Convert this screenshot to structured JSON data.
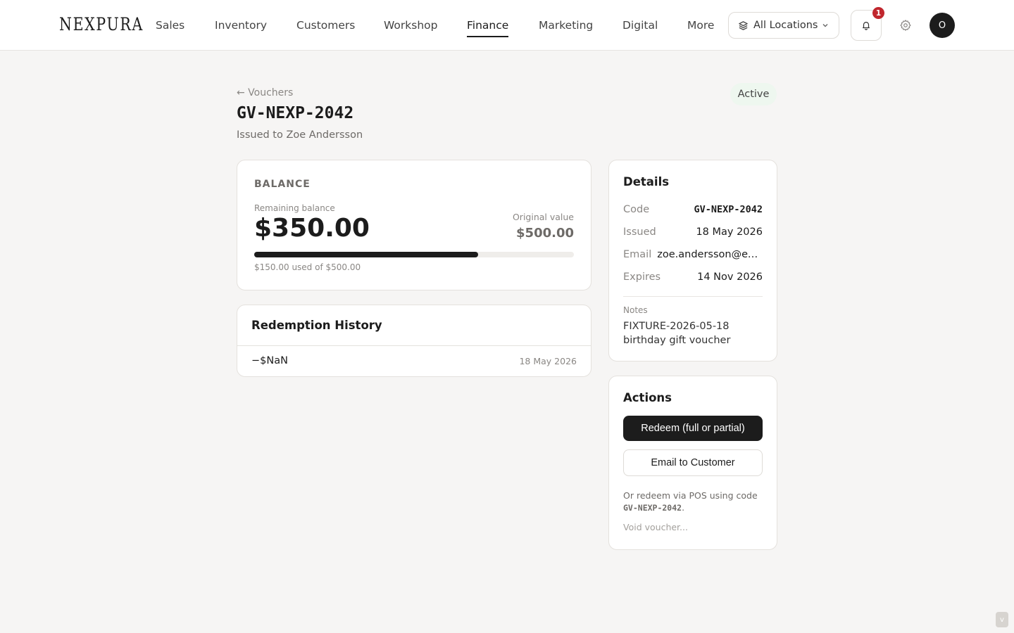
{
  "brand": {
    "logo": "NEXPURA"
  },
  "nav": {
    "items": [
      {
        "label": "Sales",
        "active": false
      },
      {
        "label": "Inventory",
        "active": false
      },
      {
        "label": "Customers",
        "active": false
      },
      {
        "label": "Workshop",
        "active": false
      },
      {
        "label": "Finance",
        "active": true
      },
      {
        "label": "Marketing",
        "active": false
      },
      {
        "label": "Digital",
        "active": false
      },
      {
        "label": "More",
        "active": false
      }
    ],
    "location_selector": "All Locations",
    "notification_count": "1",
    "avatar_initial": "O"
  },
  "header": {
    "back_link": "← Vouchers",
    "title": "GV-NEXP-2042",
    "subtitle": "Issued to Zoe Andersson",
    "status": "Active"
  },
  "balance": {
    "section_label": "BALANCE",
    "remaining_label": "Remaining balance",
    "remaining_value": "$350.00",
    "original_label": "Original value",
    "original_value": "$500.00",
    "used_fraction": 0.7,
    "used_text": "$150.00 used of $500.00"
  },
  "history": {
    "title": "Redemption History",
    "rows": [
      {
        "amount": "−$NaN",
        "date": "18 May 2026"
      }
    ]
  },
  "details": {
    "title": "Details",
    "rows": [
      {
        "key": "Code",
        "value": "GV-NEXP-2042"
      },
      {
        "key": "Issued",
        "value": "18 May 2026"
      },
      {
        "key": "Email",
        "value": "zoe.andersson@example.com"
      },
      {
        "key": "Expires",
        "value": "14 Nov 2026"
      }
    ],
    "notes_label": "Notes",
    "notes": "FIXTURE-2026-05-18 birthday gift voucher"
  },
  "actions": {
    "title": "Actions",
    "redeem_label": "Redeem (full or partial)",
    "email_label": "Email to Customer",
    "pos_prefix": "Or redeem via POS using code",
    "pos_code": "GV-NEXP-2042",
    "pos_suffix": ".",
    "void_label": "Void voucher..."
  },
  "colors": {
    "accent": "#1c1c1c",
    "badge_red": "#c0262d",
    "status_bg": "#eef7ef",
    "page_bg": "#f6f5f4"
  },
  "icons": {
    "location": "layers-icon",
    "dropdown": "chevron-down-icon",
    "notifications": "bell-icon",
    "settings": "gear-icon"
  },
  "misc": {
    "corner_button": "v"
  }
}
